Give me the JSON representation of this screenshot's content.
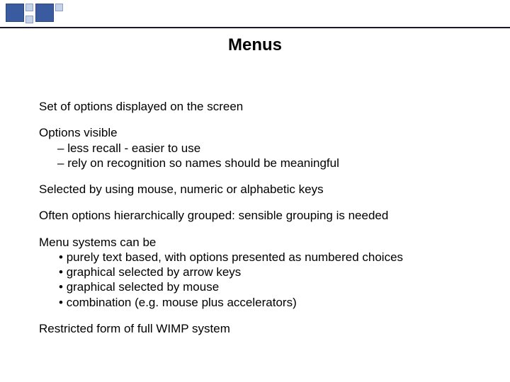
{
  "title": "Menus",
  "p1": "Set of options displayed on the screen",
  "p2_lead": "Options visible",
  "p2_sub1": "less recall - easier to use",
  "p2_sub2": "rely on recognition so names should be meaningful",
  "p3": "Selected by using mouse, numeric or alphabetic keys",
  "p4": "Often options hierarchically grouped: sensible grouping is needed",
  "p5_lead": "Menu systems can be",
  "p5_b1": "purely text based, with options presented as numbered choices",
  "p5_b2": "graphical selected by arrow keys",
  "p5_b3": "graphical selected by mouse",
  "p5_b4": "combination  (e.g. mouse plus accelerators)",
  "p6": "Restricted form of full WIMP system"
}
